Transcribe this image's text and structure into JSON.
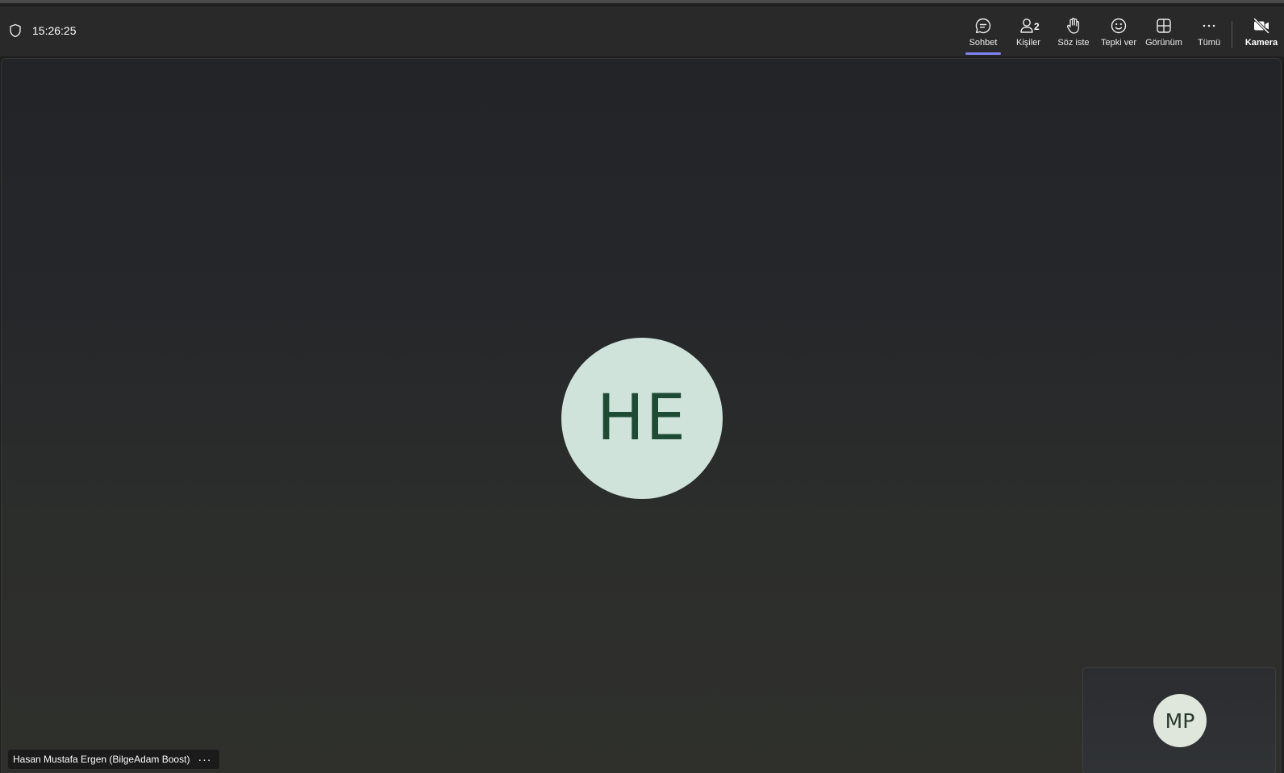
{
  "meeting": {
    "timer": "15:26:25"
  },
  "toolbar": {
    "chat_label": "Sohbet",
    "people_label": "Kişiler",
    "people_count": "2",
    "raise_hand_label": "Söz iste",
    "react_label": "Tepki ver",
    "view_label": "Görünüm",
    "more_label": "Tümü",
    "camera_label": "Kamera",
    "active_tab": "chat",
    "accent_color": "#7f85f5"
  },
  "stage": {
    "main_participant": {
      "initials": "HE",
      "name": "Hasan Mustafa Ergen (BilgeAdam Boost)",
      "avatar_bg": "#cfe3da",
      "avatar_fg": "#1f4a34"
    },
    "self_view": {
      "initials": "MP",
      "avatar_bg": "#dfe6dc"
    },
    "more_options_glyph": "···"
  },
  "icons": [
    "shield-icon",
    "chat-icon",
    "people-icon",
    "hand-icon",
    "smiley-icon",
    "view-grid-icon",
    "more-icon",
    "camera-off-icon"
  ]
}
